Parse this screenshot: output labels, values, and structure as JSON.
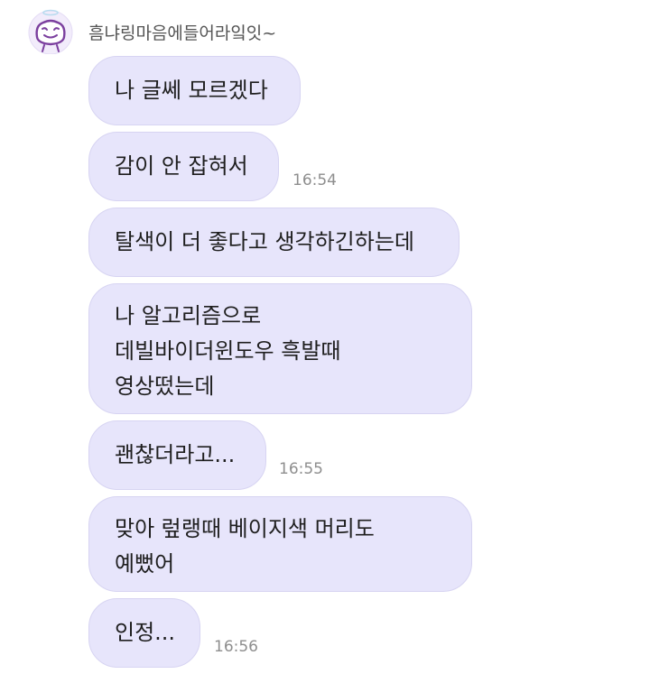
{
  "sender": {
    "name": "흠냐링마음에들어라잌잇~"
  },
  "messages": [
    {
      "lines": [
        "나 글쎄 모르겠다"
      ],
      "time": ""
    },
    {
      "lines": [
        "감이 안 잡혀서"
      ],
      "time": "16:54"
    },
    {
      "lines": [
        "탈색이 더 좋다고 생각하긴하는데"
      ],
      "time": ""
    },
    {
      "lines": [
        "나 알고리즘으로",
        "데빌바이더윈도우 흑발때",
        "영상떴는데"
      ],
      "time": ""
    },
    {
      "lines": [
        "괜찮더라고..."
      ],
      "time": "16:55"
    },
    {
      "lines": [
        "맞아 렆랭때 베이지색 머리도",
        "예뻤어"
      ],
      "time": ""
    },
    {
      "lines": [
        "인정..."
      ],
      "time": "16:56"
    }
  ],
  "colors": {
    "bubble": "#e7e5fb",
    "bubble_border": "#d7d4f2",
    "avatar_ring": "#f2ecfb",
    "avatar_stroke": "#7b3f9e"
  },
  "icons": {
    "avatar": "cartoon-face-with-halo-icon"
  }
}
